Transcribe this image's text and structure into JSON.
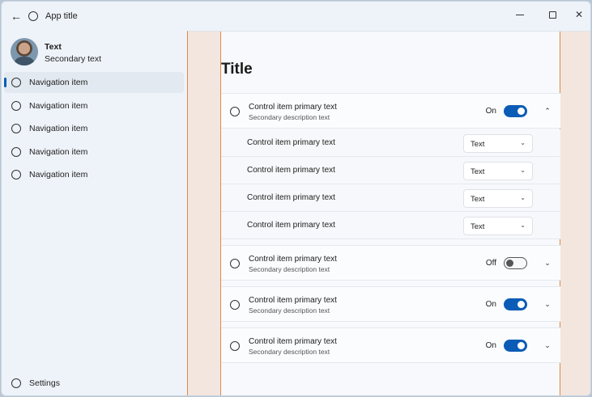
{
  "app": {
    "title": "App title"
  },
  "user": {
    "name": "Text",
    "secondary": "Secondary text"
  },
  "nav": {
    "items": [
      {
        "label": "Navigation item",
        "selected": true
      },
      {
        "label": "Navigation item",
        "selected": false
      },
      {
        "label": "Navigation item",
        "selected": false
      },
      {
        "label": "Navigation item",
        "selected": false
      },
      {
        "label": "Navigation item",
        "selected": false
      }
    ],
    "footer_label": "Settings"
  },
  "page": {
    "title": "Title"
  },
  "cards": [
    {
      "primary": "Control item primary text",
      "secondary": "Secondary description text",
      "state": "On",
      "expanded": true
    },
    {
      "primary": "Control item primary text",
      "secondary": "Secondary description text",
      "state": "Off",
      "expanded": false
    },
    {
      "primary": "Control item primary text",
      "secondary": "Secondary description text",
      "state": "On",
      "expanded": false
    },
    {
      "primary": "Control item primary text",
      "secondary": "Secondary description text",
      "state": "On",
      "expanded": false
    }
  ],
  "subrows": [
    {
      "label": "Control item primary text",
      "value": "Text"
    },
    {
      "label": "Control item primary text",
      "value": "Text"
    },
    {
      "label": "Control item primary text",
      "value": "Text"
    },
    {
      "label": "Control item primary text",
      "value": "Text"
    }
  ],
  "icons": {
    "back": "arrow-left-icon",
    "app": "app-circle-icon",
    "minimize": "minimize-icon",
    "maximize": "maximize-icon",
    "close": "close-icon",
    "nav_item": "circle-icon",
    "expand": "chevron-down-icon",
    "collapse": "chevron-up-icon"
  },
  "colors": {
    "accent": "#0b5cb6",
    "content_bg": "#f3e6df",
    "guide_line": "#e08a4a",
    "nav_bg": "#eef3f9"
  }
}
